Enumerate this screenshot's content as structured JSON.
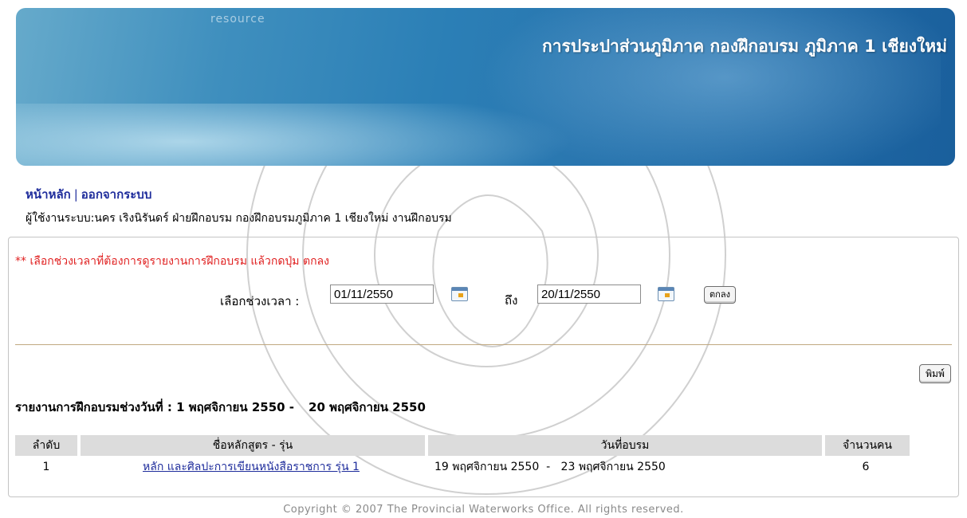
{
  "header": {
    "banner_title": "การประปาส่วนภูมิภาค กองฝึกอบรม ภูมิภาค 1 เชียงใหม่",
    "banner_blur_text": "resource"
  },
  "nav": {
    "home": "หน้าหลัก",
    "separator": "|",
    "logout": "ออกจากระบบ"
  },
  "user_info": "ผู้ใช้งานระบบ:นคร เริงนิรันดร์ ฝ่ายฝึกอบรม  กองฝึกอบรมภูมิภาค 1 เชียงใหม่  งานฝึกอบรม",
  "filter": {
    "instruction": "** เลือกช่วงเวลาที่ต้องการดูรายงานการฝึกอบรม แล้วกดปุ่ม ตกลง",
    "range_label": "เลือกช่วงเวลา :",
    "date_from": "01/11/2550",
    "to_label": "ถึง",
    "date_to": "20/11/2550",
    "ok_button": "ตกลง"
  },
  "print_button": "พิมพ์",
  "report": {
    "title_prefix": "รายงานการฝึกอบรมช่วงวันที่ : 1 พฤศจิกายน 2550  -",
    "title_end": "20 พฤศจิกายน 2550",
    "columns": [
      "ลำดับ",
      "ชื่อหลักสูตร - รุ่น",
      "วันที่อบรม",
      "จำนวนคน"
    ],
    "rows": [
      {
        "no": "1",
        "course": "หลัก และศิลปะการเขียนหนังสือราชการ รุ่น 1",
        "dates": "19 พฤศจิกายน 2550  -   23 พฤศจิกายน 2550",
        "count": "6"
      }
    ]
  },
  "footer": "Copyright © 2007 The Provincial Waterworks Office. All rights reserved.",
  "colors": {
    "link": "#1f2d9c",
    "instruction": "#e02020",
    "banner": "#2a77b0"
  }
}
